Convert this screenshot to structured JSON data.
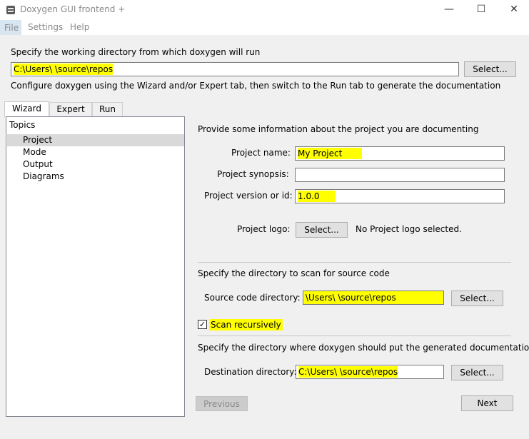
{
  "window": {
    "title": "Doxygen GUI frontend +",
    "controls": {
      "minimize": "—",
      "maximize": "☐",
      "close": "✕"
    }
  },
  "menu": {
    "file": "File",
    "settings": "Settings",
    "help": "Help"
  },
  "working_dir": {
    "prompt": "Specify the working directory from which doxygen will run",
    "value": "C:\\Users\\         \\source\\repos",
    "select_label": "Select...",
    "hint": "Configure doxygen using the Wizard and/or Expert tab, then switch to the Run tab to generate the documentation"
  },
  "tabs": [
    {
      "label": "Wizard"
    },
    {
      "label": "Expert"
    },
    {
      "label": "Run"
    }
  ],
  "topics": {
    "title": "Topics",
    "items": [
      {
        "label": "Project"
      },
      {
        "label": "Mode"
      },
      {
        "label": "Output"
      },
      {
        "label": "Diagrams"
      }
    ]
  },
  "project": {
    "intro": "Provide some information about the project you are documenting",
    "name_label": "Project name:",
    "name_value": "My Project",
    "synopsis_label": "Project synopsis:",
    "synopsis_value": "",
    "version_label": "Project version or id:",
    "version_value": "1.0.0",
    "logo_label": "Project logo:",
    "logo_select_label": "Select...",
    "logo_status": "No Project logo selected."
  },
  "source": {
    "heading": "Specify the directory to scan for source code",
    "dir_label": "Source code directory:",
    "dir_value": "\\Users\\         \\source\\repos",
    "select_label": "Select...",
    "recursive_label": "Scan recursively",
    "recursive_checked": true
  },
  "destination": {
    "heading": "Specify the directory where doxygen should put the generated documentation",
    "dir_label": "Destination directory:",
    "dir_value": "C:\\Users\\         \\source\\repos",
    "select_label": "Select..."
  },
  "nav": {
    "previous": "Previous",
    "next": "Next"
  },
  "colors": {
    "highlight": "#ffff00",
    "window_bg": "#f0f0f0"
  }
}
